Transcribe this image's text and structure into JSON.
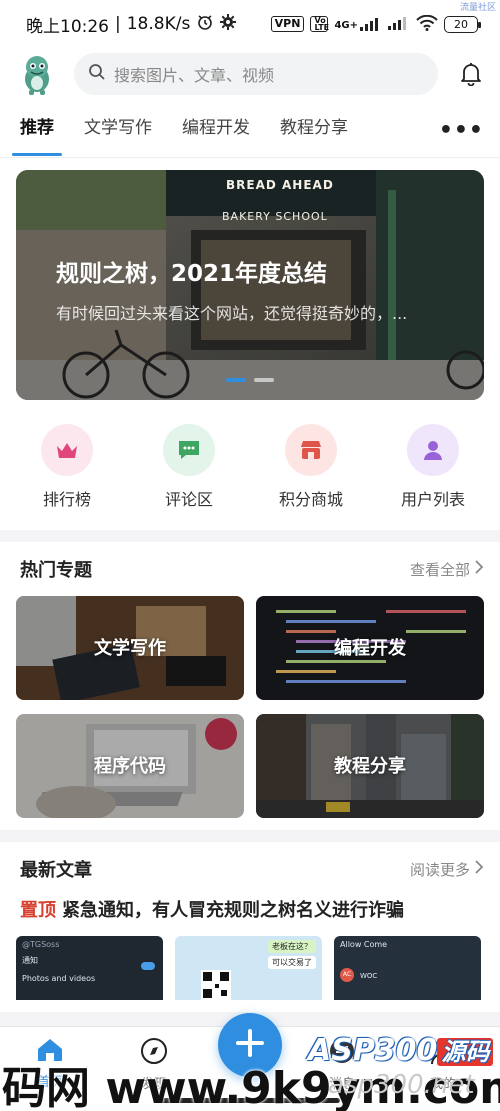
{
  "status": {
    "time": "晚上10:26",
    "net_speed": "18.8K/s",
    "vpn": "VPN",
    "volte": "Vo LTE",
    "net_type": "4G+",
    "battery": "20",
    "corner_mark": "流量社区"
  },
  "header": {
    "search_placeholder": "搜索图片、文章、视频"
  },
  "tabs": [
    {
      "label": "推荐",
      "active": true
    },
    {
      "label": "文学写作"
    },
    {
      "label": "编程开发"
    },
    {
      "label": "教程分享"
    }
  ],
  "banner": {
    "title": "规则之树，2021年度总结",
    "subtitle": "有时候回过头来看这个网站，还觉得挺奇妙的，...",
    "sign_text": "BREAD AHEAD",
    "sign_sub": "BAKERY SCHOOL",
    "dots_count": 2,
    "active_dot": 0
  },
  "quick_entries": [
    {
      "label": "排行榜",
      "icon": "crown-icon",
      "bg": "#fde7ef",
      "fg": "#e0457b"
    },
    {
      "label": "评论区",
      "icon": "chat-bubble-icon",
      "bg": "#e3f4ea",
      "fg": "#3fa563"
    },
    {
      "label": "积分商城",
      "icon": "store-icon",
      "bg": "#fde5e3",
      "fg": "#e0554a"
    },
    {
      "label": "用户列表",
      "icon": "user-icon",
      "bg": "#efe6fb",
      "fg": "#9a62d8"
    }
  ],
  "hot_topics": {
    "title": "热门专题",
    "more": "查看全部",
    "items": [
      {
        "label": "文学写作"
      },
      {
        "label": "编程开发"
      },
      {
        "label": "程序代码"
      },
      {
        "label": "教程分享"
      }
    ]
  },
  "latest": {
    "title": "最新文章",
    "more": "阅读更多",
    "pinned_tag": "置顶",
    "pinned_title": "紧急通知，有人冒充规则之树名义进行诈骗",
    "thumb_texts": [
      "@TGSoss",
      "通知",
      "Photos and videos",
      "老板在这？",
      "可以交易了",
      "Allow Come",
      "AC",
      "WOC"
    ]
  },
  "bottom_nav": {
    "items": [
      {
        "label": "首页",
        "icon": "home-icon"
      },
      {
        "label": "发现",
        "icon": "compass-icon"
      },
      {
        "label": "发布",
        "icon": "plus-icon"
      },
      {
        "label": "消息",
        "icon": "message-icon"
      },
      {
        "label": "我的",
        "icon": "profile-icon"
      }
    ]
  },
  "watermark": {
    "left": "码网 www.9k9ym.com",
    "logo": "ASP300",
    "logo_red": "源码",
    "url": "asp300.net"
  },
  "colors": {
    "accent": "#2f8ee0",
    "pinned": "#d6402f"
  }
}
